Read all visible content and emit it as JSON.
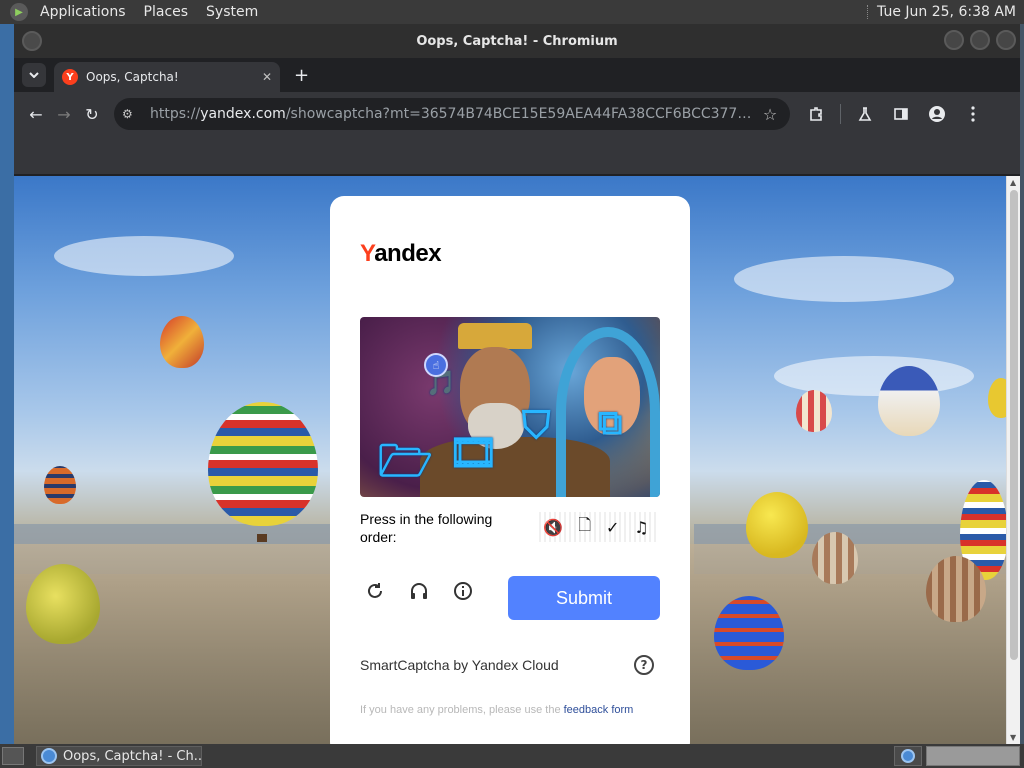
{
  "top_panel": {
    "menus": [
      "Applications",
      "Places",
      "System"
    ],
    "clock": "Tue Jun 25,  6:38 AM"
  },
  "window": {
    "title": "Oops, Captcha! - Chromium"
  },
  "tab": {
    "favicon_letter": "Y",
    "title": "Oops, Captcha!",
    "close_glyph": "✕",
    "new_tab_glyph": "+"
  },
  "toolbar": {
    "back_glyph": "←",
    "forward_glyph": "→",
    "reload_glyph": "↻",
    "url_scheme": "https://",
    "url_host": "yandex.com",
    "url_path": "/showcaptcha?mt=36574B74BCE15E59AEA44FA38CCF6BCC3770C516E9...",
    "star_glyph": "☆"
  },
  "captcha": {
    "logo_first": "Y",
    "logo_rest": "andex",
    "instruction": "Press in the following order:",
    "order_glyphs": [
      "🔇",
      "🗋",
      "✓",
      "♫"
    ],
    "image_glyphs": [
      "🎵",
      "🗁",
      "🎞",
      "⛉",
      "⧉"
    ],
    "submit_label": "Submit",
    "powered_by": "SmartCaptcha by Yandex Cloud",
    "feedback_text": "If you have any problems, please use the ",
    "feedback_link": "feedback form"
  },
  "taskbar": {
    "task_title": "Oops, Captcha! - Ch..."
  },
  "colors": {
    "submit": "#5282ff",
    "yandex_red": "#fc3f1d",
    "feedback_link": "#2f4f9a"
  }
}
